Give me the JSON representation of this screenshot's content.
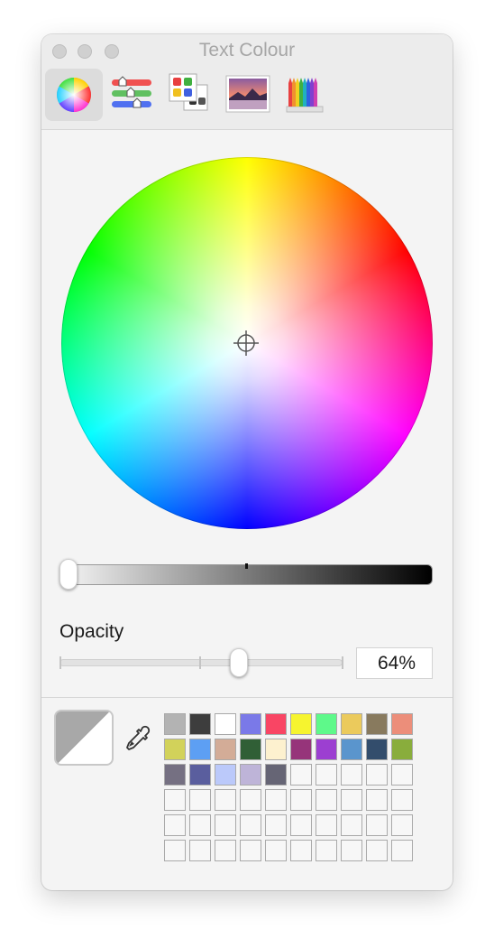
{
  "window": {
    "title": "Text Colour"
  },
  "toolbar": {
    "modes": [
      "colour-wheel",
      "colour-sliders",
      "colour-palettes",
      "image-palettes",
      "pencils"
    ],
    "active": "colour-wheel"
  },
  "opacity": {
    "label": "Opacity",
    "value_text": "64%",
    "value": 0.64
  },
  "brightness": {
    "value": 0.0
  },
  "preview": {
    "colors": [
      "#a8a8a8",
      "#ffffff"
    ]
  },
  "swatches": [
    "#b3b3b3",
    "#3d3d3d",
    "#ffffff",
    "#7a79e8",
    "#f94564",
    "#f6f42f",
    "#5ef98a",
    "#ebca5c",
    "#887a5e",
    "#ec8e7a",
    "#d2d25a",
    "#5d9ff3",
    "#d3ac97",
    "#305f36",
    "#fdf1cf",
    "#96347a",
    "#9c3fd1",
    "#5a95cd",
    "#334d6c",
    "#89ad3c",
    "#757082",
    "#5a5e9e",
    "#bbc9fa",
    "#beb4d8",
    "#666575"
  ]
}
